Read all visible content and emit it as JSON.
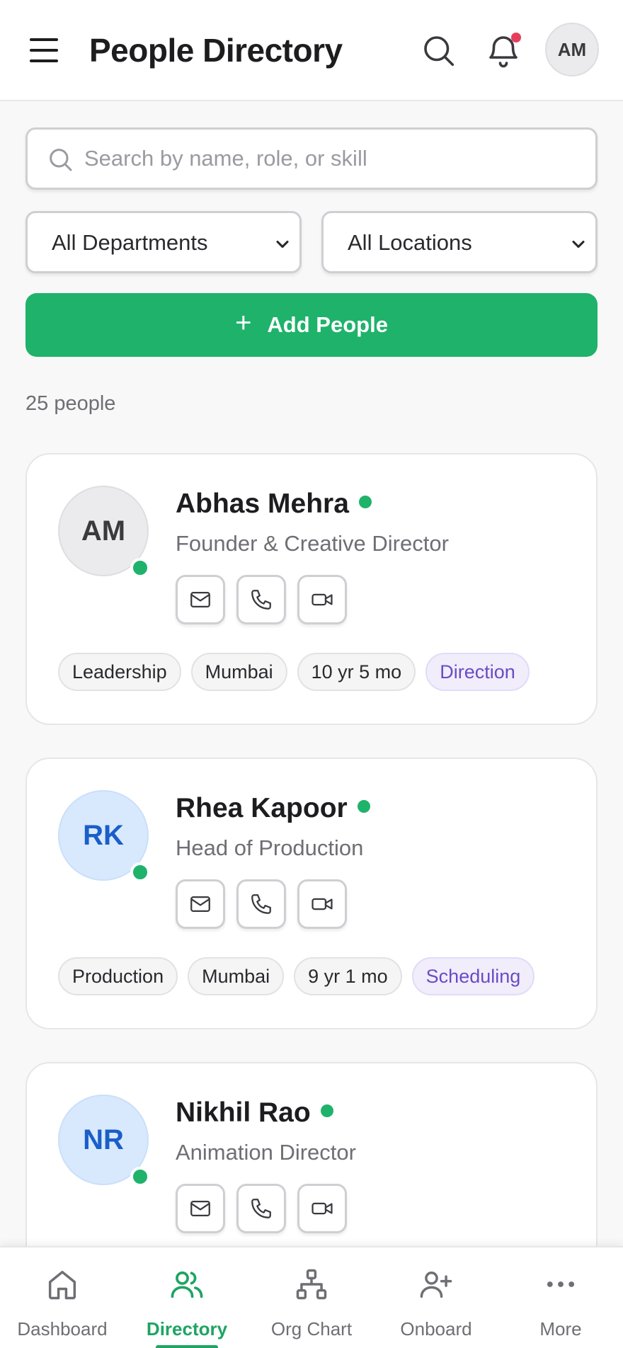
{
  "header": {
    "title": "People Directory",
    "user_initials": "AM"
  },
  "search": {
    "placeholder": "Search by name, role, or skill",
    "value": ""
  },
  "filters": {
    "department": "All Departments",
    "location": "All Locations"
  },
  "add_button": {
    "label": "Add People"
  },
  "count_text": "25 people",
  "people": [
    {
      "initials": "AM",
      "name": "Abhas Mehra",
      "role": "Founder & Creative Director",
      "tags": [
        "Leadership",
        "Mumbai",
        "10 yr 5 mo"
      ],
      "skill": "Direction",
      "avatar_color": "#ebebed"
    },
    {
      "initials": "RK",
      "name": "Rhea Kapoor",
      "role": "Head of Production",
      "tags": [
        "Production",
        "Mumbai",
        "9 yr 1 mo"
      ],
      "skill": "Scheduling",
      "avatar_color": "#d8e9fd"
    },
    {
      "initials": "NR",
      "name": "Nikhil Rao",
      "role": "Animation Director",
      "tags": [],
      "skill": "",
      "avatar_color": "#d8e9fd"
    }
  ],
  "bottom_nav": [
    {
      "label": "Dashboard",
      "icon": "home-icon",
      "active": false
    },
    {
      "label": "Directory",
      "icon": "users-icon",
      "active": true
    },
    {
      "label": "Org Chart",
      "icon": "org-chart-icon",
      "active": false
    },
    {
      "label": "Onboard",
      "icon": "user-plus-icon",
      "active": false
    },
    {
      "label": "More",
      "icon": "more-icon",
      "active": false
    }
  ],
  "colors": {
    "accent": "#1fb26b",
    "status_online": "#1fb26b",
    "notification": "#e53e5d",
    "skill_tag": "#6a4cc4"
  }
}
